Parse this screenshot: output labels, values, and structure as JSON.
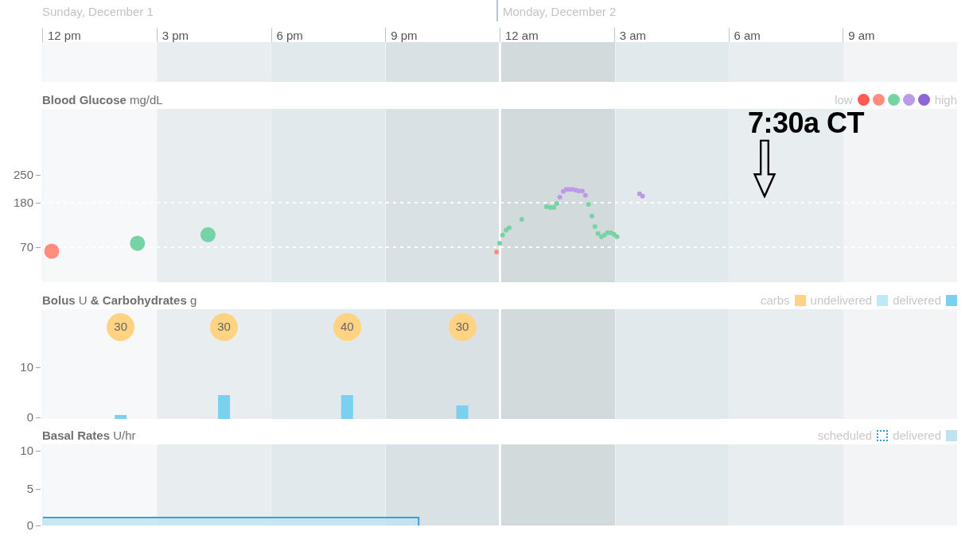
{
  "timeline": {
    "dates": [
      {
        "label": "Sunday, December 1"
      },
      {
        "label": "Monday, December 2"
      }
    ],
    "ticks": [
      "12 pm",
      "3 pm",
      "6 pm",
      "9 pm",
      "12 am",
      "3 am",
      "6 am",
      "9 am"
    ]
  },
  "blood_glucose": {
    "title": "Blood Glucose",
    "unit": "mg/dL",
    "legend": {
      "low_label": "low",
      "high_label": "high",
      "dots": [
        {
          "color": "#ff5a50"
        },
        {
          "color": "#ff8c7c"
        },
        {
          "color": "#76d3a6"
        },
        {
          "color": "#bb9ae7"
        },
        {
          "color": "#8c65d6"
        }
      ]
    },
    "annotation": {
      "text": "7:30a CT"
    },
    "axis_labels": [
      "250",
      "180",
      "70"
    ]
  },
  "bolus": {
    "title": "Bolus",
    "unit": "U",
    "joiner": "& Carbohydrates",
    "unit2": "g",
    "legend": [
      {
        "label": "carbs",
        "color": "#ffd382"
      },
      {
        "label": "undelivered",
        "color": "#bde9f8"
      },
      {
        "label": "delivered",
        "color": "#7bcfef"
      }
    ],
    "carbs": [
      {
        "value": "30"
      },
      {
        "value": "30"
      },
      {
        "value": "40"
      },
      {
        "value": "30"
      }
    ],
    "axis_labels": [
      "10",
      "0"
    ]
  },
  "basal": {
    "title": "Basal Rates",
    "unit": "U/hr",
    "legend": [
      {
        "label": "scheduled",
        "kind": "dotted",
        "color": "#2a9fd6"
      },
      {
        "label": "delivered",
        "kind": "solid",
        "color": "#bde3f2"
      }
    ],
    "axis_labels": [
      "10",
      "5",
      "0"
    ]
  }
}
